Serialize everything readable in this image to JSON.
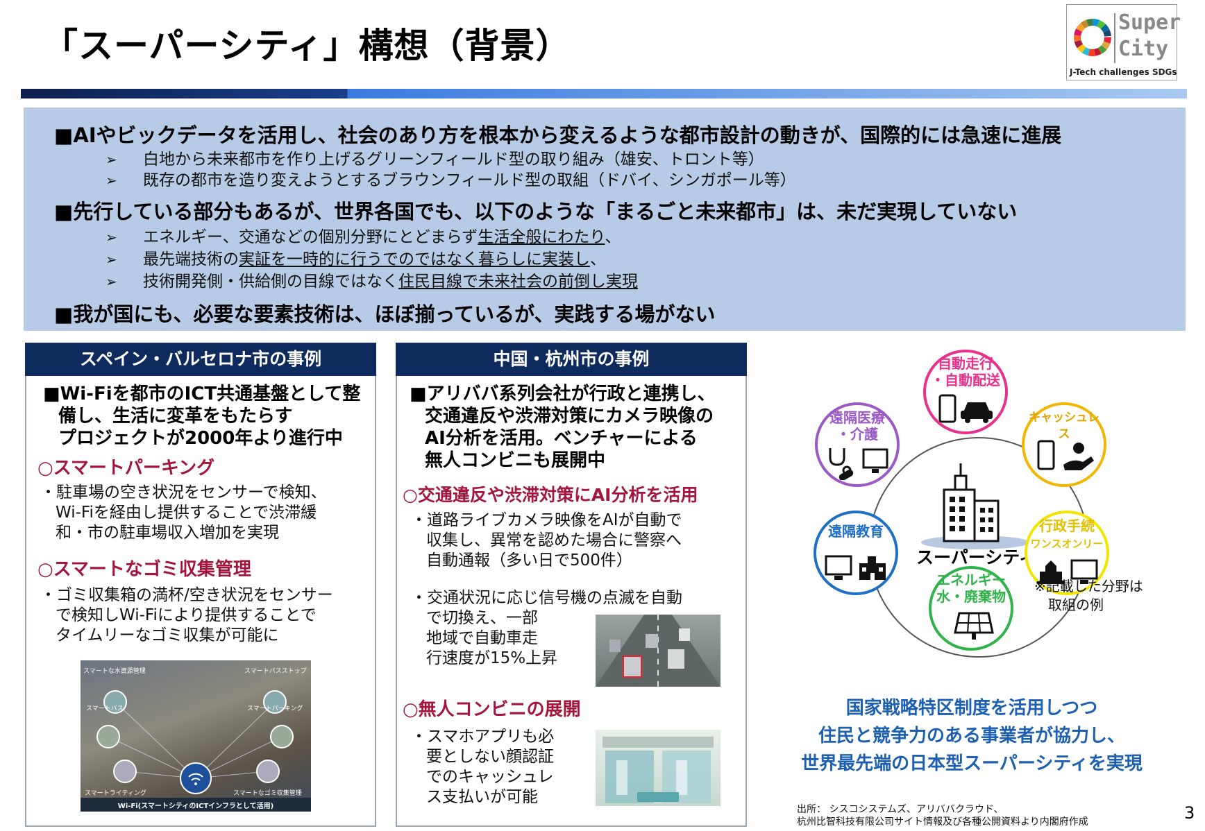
{
  "title": "「スーパーシティ」構想（背景）",
  "logo": {
    "line1": "Super",
    "line2": "City",
    "tagline": "J-Tech challenges SDGs"
  },
  "background": {
    "point1": "■AIやビックデータを活用し、社会のあり方を根本から変えるような都市設計の動きが、国際的には急速に進展",
    "point1_subs": [
      "白地から未来都市を作り上げるグリーンフィールド型の取り組み（雄安、トロント等）",
      "既存の都市を造り変えようとするブラウンフィールド型の取組（ドバイ、シンガポール等）"
    ],
    "point2": "■先行している部分もあるが、世界各国でも、以下のような「まるごと未来都市」は、未だ実現していない",
    "point2_sub1_a": "エネルギー、交通などの個別分野にとどまらず",
    "point2_sub1_b": "生活全般にわたり",
    "point2_sub1_c": "、",
    "point2_sub2_a": "最先端技術の",
    "point2_sub2_b": "実証を一時的に行うでのではなく暮らしに実装し",
    "point2_sub2_c": "、",
    "point2_sub3_a": "技術開発側・供給側の目線ではなく",
    "point2_sub3_b": "住民目線で未来社会の前倒し実現",
    "point3": "■我が国にも、必要な要素技術は、ほぼ揃っているが、実践する場がない",
    "arrow": "➢"
  },
  "barcelona": {
    "header": "スペイン・バルセロナ市の事例",
    "lead_l1": "■Wi-Fiを都市のICT共通基盤として整",
    "lead_l2": "備し、生活に変革をもたらす",
    "lead_l3": "プロジェクトが2000年より進行中",
    "sec1": "○スマートパーキング",
    "sec1_l1": "・駐車場の空き状況をセンサーで検知、",
    "sec1_l2": "Wi-Fiを経由し提供することで渋滞緩",
    "sec1_l3": "和・市の駐車場収入増加を実現",
    "sec2": "○スマートなゴミ収集管理",
    "sec2_l1": "・ゴミ収集箱の満杯/空き状況をセンサー",
    "sec2_l2": "で検知しWi-Fiにより提供することで",
    "sec2_l3": "タイムリーなゴミ収集が可能に",
    "photo_labels": [
      "スマートな水資源管理",
      "スマートバスストップ",
      "スマートバス",
      "スマートパーキング",
      "スマートライティング",
      "スマートなゴミ収集管理"
    ],
    "photo_caption": "Wi-Fi(スマートシティのICTインフラとして活用)"
  },
  "hangzhou": {
    "header": "中国・杭州市の事例",
    "lead_l1": "■アリババ系列会社が行政と連携し、",
    "lead_l2": "交通違反や渋滞対策にカメラ映像の",
    "lead_l3": "AI分析を活用。ベンチャーによる",
    "lead_l4": "無人コンビニも展開中",
    "sec1": "○交通違反や渋滞対策にAI分析を活用",
    "sec1_l1": "・道路ライブカメラ映像をAIが自動で",
    "sec1_l2": "収集し、異常を認めた場合に警察へ",
    "sec1_l3": "自動通報（多い日で500件）",
    "sec1b_l1": "・交通状況に応じ信号機の点滅を自動",
    "sec1b_l2": "で切換え、一部",
    "sec1b_l3": "地域で自動車走",
    "sec1b_l4": "行速度が15%上昇",
    "sec2": "○無人コンビニの展開",
    "sec2_l1": "・スマホアプリも必",
    "sec2_l2": "要としない顔認証",
    "sec2_l3": "でのキャッシュレ",
    "sec2_l4": "ス支払いが可能"
  },
  "diagram": {
    "center": "スーパーシティ",
    "nodes": [
      {
        "l1": "自動走行",
        "l2": "・自動配送",
        "color": "#e8318c"
      },
      {
        "l1": "キャッシュレス",
        "l2": "",
        "color": "#f2b705"
      },
      {
        "l1": "行政手続",
        "l2": "ワンスオンリー",
        "color": "#f2e600"
      },
      {
        "l1": "エネルギー",
        "l2": "水・廃棄物",
        "color": "#2fb34a"
      },
      {
        "l1": "遠隔教育",
        "l2": "",
        "color": "#1f6fc7"
      },
      {
        "l1": "遠隔医療",
        "l2": "・介護",
        "color": "#9b59c6"
      }
    ],
    "note_l1": "※記載した分野は",
    "note_l2": "取組の例"
  },
  "conclusion": {
    "l1": "国家戦略特区制度を活用しつつ",
    "l2": "住民と競争力のある事業者が協力し、",
    "l3": "世界最先端の日本型スーパーシティを実現"
  },
  "source": {
    "l1": "出所： シスコシステムズ、アリババクラウド、",
    "l2": "杭州比智科技有限公司サイト情報及び各種公開資料より内閣府作成"
  },
  "page_number": "3"
}
